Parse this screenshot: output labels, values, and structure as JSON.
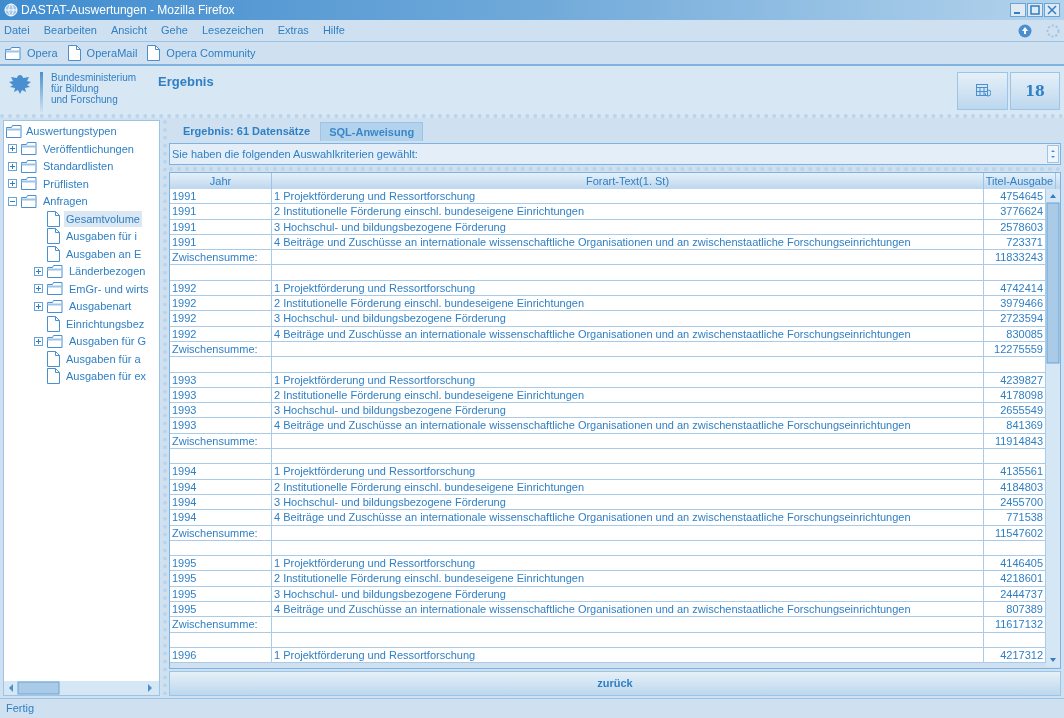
{
  "window": {
    "title": "DASTAT-Auswertungen - Mozilla Firefox"
  },
  "menu": [
    "Datei",
    "Bearbeiten",
    "Ansicht",
    "Gehe",
    "Lesezeichen",
    "Extras",
    "Hilfe"
  ],
  "bookmarks": [
    {
      "label": "Opera",
      "kind": "folder"
    },
    {
      "label": "OperaMail",
      "kind": "page"
    },
    {
      "label": "Opera Community",
      "kind": "page"
    }
  ],
  "header": {
    "ministry": "Bundesministerium\nfür Bildung\nund Forschung",
    "title": "Ergebnis",
    "day": "18"
  },
  "tree": {
    "label": "Auswertungstypen",
    "children": [
      {
        "label": "Veröffentlichungen",
        "kind": "folder",
        "expanded": false,
        "selected": false
      },
      {
        "label": "Standardlisten",
        "kind": "folder",
        "expanded": false,
        "selected": false
      },
      {
        "label": "Prüflisten",
        "kind": "folder",
        "expanded": false,
        "selected": false
      },
      {
        "label": "Anfragen",
        "kind": "folder",
        "expanded": true,
        "selected": false,
        "children": [
          {
            "label": "Gesamtvolume",
            "kind": "page",
            "selected": true
          },
          {
            "label": "Ausgaben für i",
            "kind": "page",
            "selected": false
          },
          {
            "label": "Ausgaben an E",
            "kind": "page",
            "selected": false
          },
          {
            "label": "Länderbezogen",
            "kind": "folder",
            "expanded": false,
            "selected": false
          },
          {
            "label": "EmGr- und wirts",
            "kind": "folder",
            "expanded": false,
            "selected": false
          },
          {
            "label": "Ausgabenart",
            "kind": "folder",
            "expanded": false,
            "selected": false
          },
          {
            "label": "Einrichtungsbez",
            "kind": "page",
            "selected": false
          },
          {
            "label": "Ausgaben für G",
            "kind": "folder",
            "expanded": false,
            "selected": false
          },
          {
            "label": "Ausgaben für a",
            "kind": "page",
            "selected": false
          },
          {
            "label": "Ausgaben für ex",
            "kind": "page",
            "selected": false
          }
        ]
      }
    ]
  },
  "tabs": [
    {
      "label": "Ergebnis: 61 Datensätze",
      "selected": true
    },
    {
      "label": "SQL-Anweisung",
      "selected": false
    }
  ],
  "criteria": "Sie haben die folgenden Auswahlkriterien gewählt:",
  "table": {
    "columns": [
      "Jahr",
      "Forart-Text(1. St)",
      "Titel-Ausgabe"
    ],
    "rows": [
      {
        "kind": "data",
        "year": "1991",
        "text": "1 Projektförderung und Ressortforschung",
        "amount": "4754645"
      },
      {
        "kind": "data",
        "year": "1991",
        "text": "2 Institutionelle Förderung einschl. bundeseigene Einrichtungen",
        "amount": "3776624"
      },
      {
        "kind": "data",
        "year": "1991",
        "text": "3 Hochschul- und bildungsbezogene Förderung",
        "amount": "2578603"
      },
      {
        "kind": "data",
        "year": "1991",
        "text": "4 Beiträge und Zuschüsse an internationale wissenschaftliche Organisationen und an zwischenstaatliche Forschungseinrichtungen",
        "amount": "723371"
      },
      {
        "kind": "subtotal",
        "year": "Zwischensumme:",
        "amount": "11833243"
      },
      {
        "kind": "blank"
      },
      {
        "kind": "data",
        "year": "1992",
        "text": "1 Projektförderung und Ressortforschung",
        "amount": "4742414"
      },
      {
        "kind": "data",
        "year": "1992",
        "text": "2 Institutionelle Förderung einschl. bundeseigene Einrichtungen",
        "amount": "3979466"
      },
      {
        "kind": "data",
        "year": "1992",
        "text": "3 Hochschul- und bildungsbezogene Förderung",
        "amount": "2723594"
      },
      {
        "kind": "data",
        "year": "1992",
        "text": "4 Beiträge und Zuschüsse an internationale wissenschaftliche Organisationen und an zwischenstaatliche Forschungseinrichtungen",
        "amount": "830085"
      },
      {
        "kind": "subtotal",
        "year": "Zwischensumme:",
        "amount": "12275559"
      },
      {
        "kind": "blank"
      },
      {
        "kind": "data",
        "year": "1993",
        "text": "1 Projektförderung und Ressortforschung",
        "amount": "4239827"
      },
      {
        "kind": "data",
        "year": "1993",
        "text": "2 Institutionelle Förderung einschl. bundeseigene Einrichtungen",
        "amount": "4178098"
      },
      {
        "kind": "data",
        "year": "1993",
        "text": "3 Hochschul- und bildungsbezogene Förderung",
        "amount": "2655549"
      },
      {
        "kind": "data",
        "year": "1993",
        "text": "4 Beiträge und Zuschüsse an internationale wissenschaftliche Organisationen und an zwischenstaatliche Forschungseinrichtungen",
        "amount": "841369"
      },
      {
        "kind": "subtotal",
        "year": "Zwischensumme:",
        "amount": "11914843"
      },
      {
        "kind": "blank"
      },
      {
        "kind": "data",
        "year": "1994",
        "text": "1 Projektförderung und Ressortforschung",
        "amount": "4135561"
      },
      {
        "kind": "data",
        "year": "1994",
        "text": "2 Institutionelle Förderung einschl. bundeseigene Einrichtungen",
        "amount": "4184803"
      },
      {
        "kind": "data",
        "year": "1994",
        "text": "3 Hochschul- und bildungsbezogene Förderung",
        "amount": "2455700"
      },
      {
        "kind": "data",
        "year": "1994",
        "text": "4 Beiträge und Zuschüsse an internationale wissenschaftliche Organisationen und an zwischenstaatliche Forschungseinrichtungen",
        "amount": "771538"
      },
      {
        "kind": "subtotal",
        "year": "Zwischensumme:",
        "amount": "11547602"
      },
      {
        "kind": "blank"
      },
      {
        "kind": "data",
        "year": "1995",
        "text": "1 Projektförderung und Ressortforschung",
        "amount": "4146405"
      },
      {
        "kind": "data",
        "year": "1995",
        "text": "2 Institutionelle Förderung einschl. bundeseigene Einrichtungen",
        "amount": "4218601"
      },
      {
        "kind": "data",
        "year": "1995",
        "text": "3 Hochschul- und bildungsbezogene Förderung",
        "amount": "2444737"
      },
      {
        "kind": "data",
        "year": "1995",
        "text": "4 Beiträge und Zuschüsse an internationale wissenschaftliche Organisationen und an zwischenstaatliche Forschungseinrichtungen",
        "amount": "807389"
      },
      {
        "kind": "subtotal",
        "year": "Zwischensumme:",
        "amount": "11617132"
      },
      {
        "kind": "blank"
      },
      {
        "kind": "data",
        "year": "1996",
        "text": "1 Projektförderung und Ressortforschung",
        "amount": "4217312"
      }
    ]
  },
  "back_button": "zurück",
  "status": "Fertig"
}
